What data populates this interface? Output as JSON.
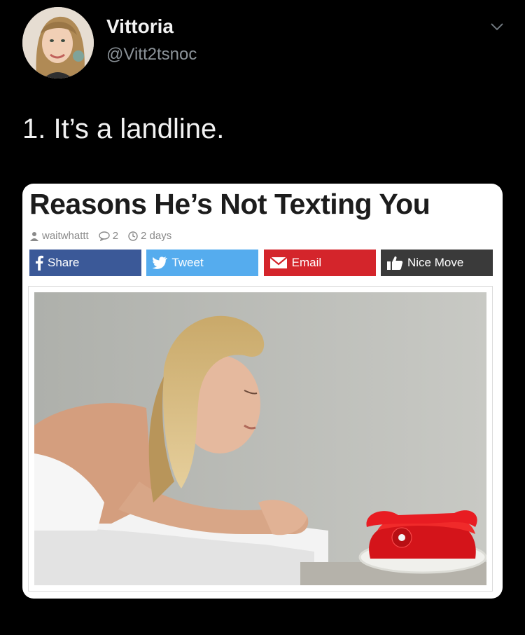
{
  "tweet": {
    "display_name": "Vittoria",
    "handle": "@Vitt2tsnoc",
    "text": "1. It’s a landline."
  },
  "article": {
    "headline": "Reasons He’s Not Texting You",
    "author": "waitwhattt",
    "comment_count": "2",
    "age": "2 days",
    "buttons": {
      "share": "Share",
      "tweet": "Tweet",
      "email": "Email",
      "nice_move": "Nice Move"
    },
    "colors": {
      "facebook": "#3b5998",
      "twitter": "#55acee",
      "email": "#d4252b",
      "nice_move": "#3a3a3a"
    }
  },
  "icons": [
    "chevron-down-icon",
    "user-icon",
    "comment-icon",
    "clock-icon",
    "facebook-icon",
    "twitter-bird-icon",
    "envelope-icon",
    "thumbs-up-icon"
  ]
}
